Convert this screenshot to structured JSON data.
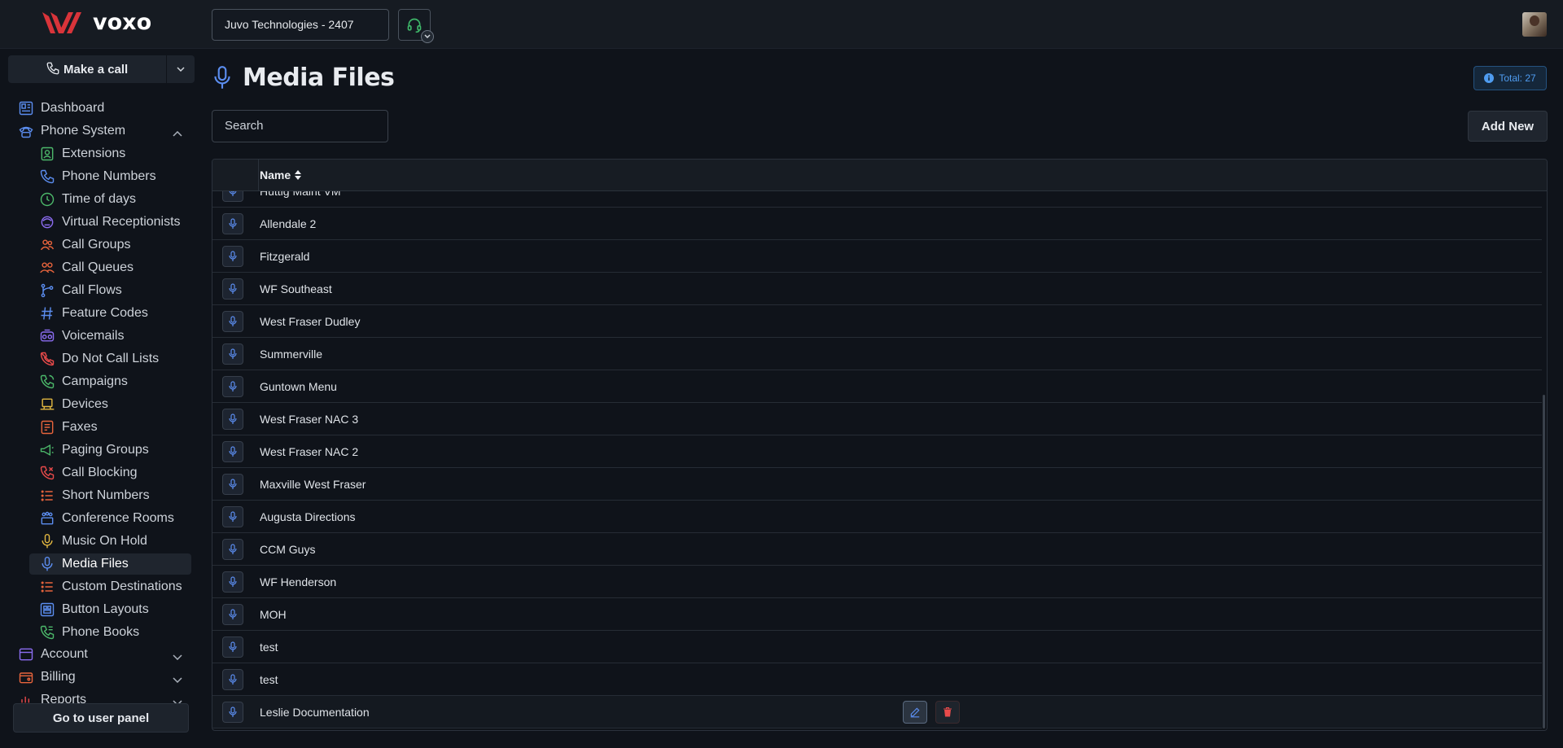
{
  "topbar": {
    "logo_text": "voxo",
    "company": "Juvo Technologies - 2407"
  },
  "sidebar": {
    "make_call": "Make a call",
    "items": [
      {
        "label": "Dashboard",
        "icon": "dashboard-icon",
        "color": "#5b8def"
      },
      {
        "label": "Phone System",
        "icon": "phone-system-icon",
        "color": "#5b8def"
      },
      {
        "label": "Extensions",
        "icon": "extensions-icon",
        "color": "#4cb86a"
      },
      {
        "label": "Phone Numbers",
        "icon": "phone-numbers-icon",
        "color": "#5b8def"
      },
      {
        "label": "Time of days",
        "icon": "clock-icon",
        "color": "#4cb86a"
      },
      {
        "label": "Virtual Receptionists",
        "icon": "receptionist-icon",
        "color": "#8b6cf0"
      },
      {
        "label": "Call Groups",
        "icon": "call-groups-icon",
        "color": "#e8643c"
      },
      {
        "label": "Call Queues",
        "icon": "call-queues-icon",
        "color": "#e8643c"
      },
      {
        "label": "Call Flows",
        "icon": "call-flows-icon",
        "color": "#5b8def"
      },
      {
        "label": "Feature Codes",
        "icon": "hash-icon",
        "color": "#5b8def"
      },
      {
        "label": "Voicemails",
        "icon": "voicemail-icon",
        "color": "#8b6cf0"
      },
      {
        "label": "Do Not Call Lists",
        "icon": "do-not-call-icon",
        "color": "#e84a4a"
      },
      {
        "label": "Campaigns",
        "icon": "campaigns-icon",
        "color": "#4cb86a"
      },
      {
        "label": "Devices",
        "icon": "devices-icon",
        "color": "#e0b640"
      },
      {
        "label": "Faxes",
        "icon": "fax-icon",
        "color": "#e8643c"
      },
      {
        "label": "Paging Groups",
        "icon": "megaphone-icon",
        "color": "#4cb86a"
      },
      {
        "label": "Call Blocking",
        "icon": "call-blocking-icon",
        "color": "#e84a4a"
      },
      {
        "label": "Short Numbers",
        "icon": "list-icon",
        "color": "#e8643c"
      },
      {
        "label": "Conference Rooms",
        "icon": "conference-icon",
        "color": "#5b8def"
      },
      {
        "label": "Music On Hold",
        "icon": "music-mic-icon",
        "color": "#e0b640"
      },
      {
        "label": "Media Files",
        "icon": "microphone-icon",
        "color": "#5b8def"
      },
      {
        "label": "Custom Destinations",
        "icon": "list-icon",
        "color": "#e8643c"
      },
      {
        "label": "Button Layouts",
        "icon": "button-layouts-icon",
        "color": "#5b8def"
      },
      {
        "label": "Phone Books",
        "icon": "phone-book-icon",
        "color": "#4cb86a"
      },
      {
        "label": "Account",
        "icon": "account-icon",
        "color": "#8b6cf0"
      },
      {
        "label": "Billing",
        "icon": "billing-icon",
        "color": "#e8643c"
      },
      {
        "label": "Reports",
        "icon": "reports-icon",
        "color": "#e84a4a"
      }
    ],
    "user_panel": "Go to user panel"
  },
  "main": {
    "title": "Media Files",
    "total": "Total: 27",
    "search_placeholder": "Search",
    "add_new": "Add New",
    "column_name": "Name",
    "rows": [
      "Huttig Maint VM",
      "Allendale 2",
      "Fitzgerald",
      "WF Southeast",
      "West Fraser Dudley",
      "Summerville",
      "Guntown Menu",
      "West Fraser NAC 3",
      "West Fraser NAC 2",
      "Maxville West Fraser",
      "Augusta Directions",
      "CCM Guys",
      "WF Henderson",
      "MOH",
      "test",
      "test",
      "Leslie Documentation"
    ]
  },
  "colors": {
    "accent": "#5b8def",
    "delete": "#e84a4a",
    "background": "#0f131a"
  }
}
